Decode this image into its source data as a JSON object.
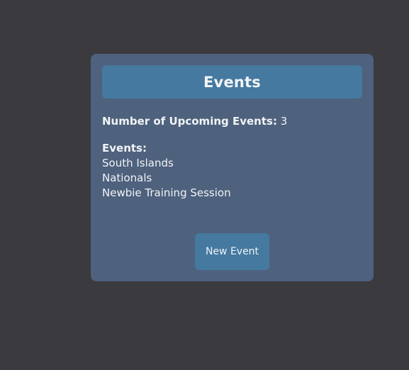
{
  "card": {
    "title": "Events",
    "upcoming_label": "Number of Upcoming Events:",
    "upcoming_count": "3",
    "events_label": "Events:",
    "events": [
      "South Islands",
      "Nationals",
      "Newbie Training Session"
    ],
    "new_event_button": "New Event"
  },
  "colors": {
    "page_background": "#3b3a3f",
    "card_background": "#4e617d",
    "accent": "#4579a0",
    "text": "#f1f3f6"
  }
}
